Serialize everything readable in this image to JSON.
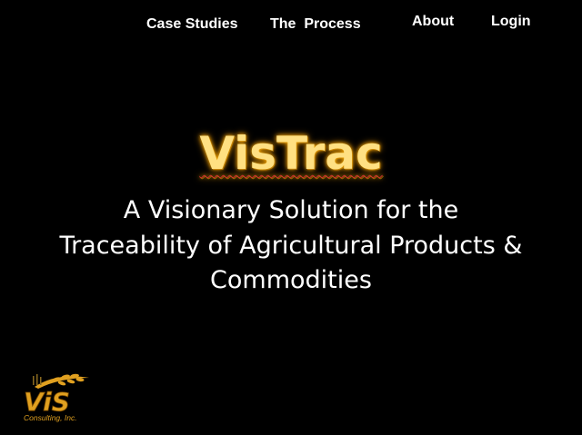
{
  "nav": {
    "case_studies": "Case Studies",
    "the_process": "The  Process",
    "about": "About",
    "login": "Login"
  },
  "hero": {
    "title": "VisTrac",
    "tagline_line1": "A Visionary Solution for the",
    "tagline_line2": "Traceability of Agricultural Products &",
    "tagline_line3": "Commodities"
  },
  "logo": {
    "mark": "ViS",
    "company": "Consulting, Inc.",
    "icon": "wheat-icon"
  },
  "colors": {
    "background": "#000000",
    "title_fill": "#ffe082",
    "title_glow": "#f0a500",
    "logo_gold": "#e0a020"
  }
}
